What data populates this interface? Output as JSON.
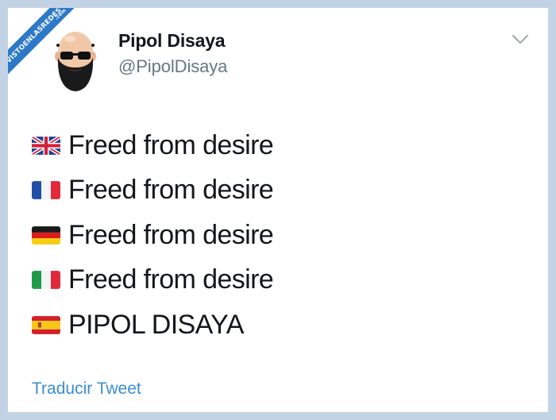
{
  "watermark": {
    "text": "VISTOENLASREDES",
    "suffix": ".com"
  },
  "tweet": {
    "author": {
      "display_name": "Pipol Disaya",
      "handle": "@PipolDisaya",
      "avatar_icon": "bearded-man-sunglasses-avatar"
    },
    "menu_icon": "chevron-down-icon",
    "lines": [
      {
        "flag": "flag-uk-icon",
        "text": "Freed from desire"
      },
      {
        "flag": "flag-france-icon",
        "text": "Freed from desire"
      },
      {
        "flag": "flag-germany-icon",
        "text": "Freed from desire"
      },
      {
        "flag": "flag-italy-icon",
        "text": "Freed from desire"
      },
      {
        "flag": "flag-spain-icon",
        "text": "PIPOL DISAYA"
      }
    ],
    "translate_label": "Traducir Tweet"
  },
  "colors": {
    "background": "#c3d3e6",
    "card": "#ffffff",
    "text": "#14171a",
    "muted": "#657786",
    "link": "#3b8ecf",
    "watermark": "#2d79c7"
  }
}
